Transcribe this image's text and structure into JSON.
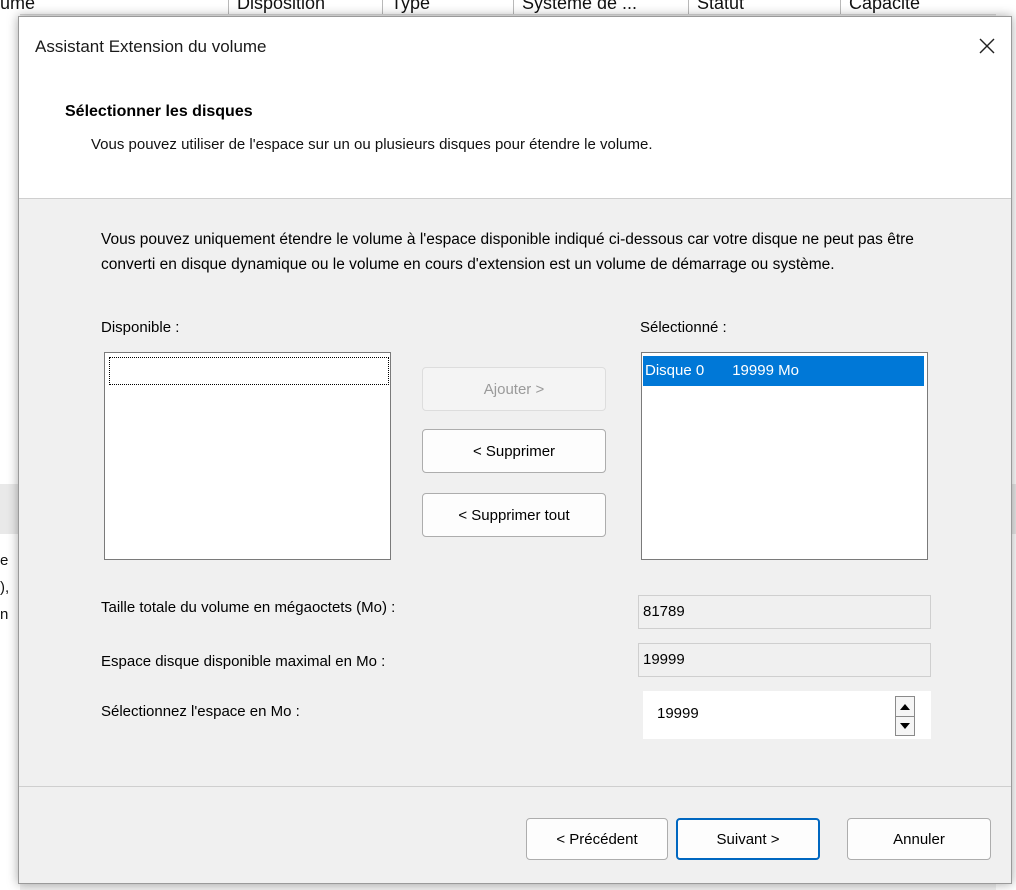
{
  "background_window": {
    "columns": [
      "ume",
      "Disposition",
      "Type",
      "Système de ...",
      "Statut",
      "Capacité"
    ],
    "left_fragments": [
      "e",
      "),",
      "n"
    ]
  },
  "dialog": {
    "title": "Assistant Extension du volume",
    "header": {
      "title": "Sélectionner les disques",
      "description": "Vous pouvez utiliser de l'espace sur un ou plusieurs disques pour étendre le volume."
    },
    "body_text": "Vous pouvez uniquement étendre le volume à l'espace disponible indiqué ci-dessous car votre disque ne peut pas être converti en disque dynamique ou le volume en cours d'extension est un volume de démarrage ou système.",
    "available": {
      "label": "Disponible :",
      "items": []
    },
    "selected": {
      "label": "Sélectionné :",
      "items": [
        {
          "disk": "Disque 0",
          "size": "19999 Mo"
        }
      ]
    },
    "buttons": {
      "add": "Ajouter >",
      "remove": "< Supprimer",
      "remove_all": "< Supprimer tout",
      "back": "< Précédent",
      "next": "Suivant >",
      "cancel": "Annuler"
    },
    "fields": {
      "total_size_label": "Taille totale du volume en mégaoctets (Mo) :",
      "total_size_value": "81789",
      "max_space_label": "Espace disque disponible maximal en Mo :",
      "max_space_value": "19999",
      "select_space_label": "Sélectionnez l'espace en Mo :",
      "select_space_value": "19999"
    }
  },
  "colors": {
    "selection": "#0078d7",
    "default_button_border": "#0067c0"
  }
}
